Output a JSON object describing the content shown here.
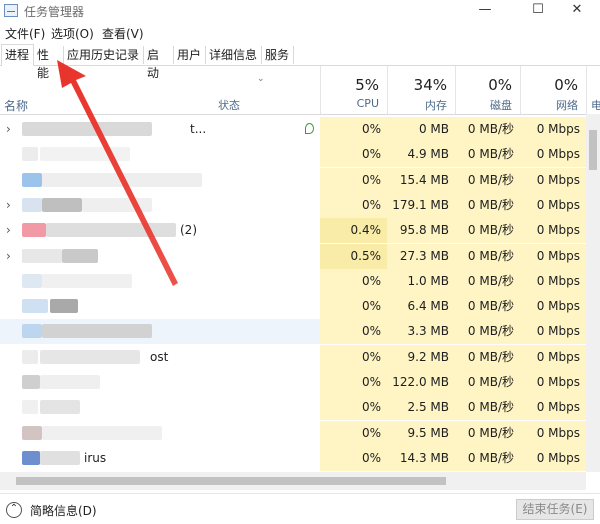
{
  "window": {
    "title": "任务管理器",
    "controls": {
      "minimize": "—",
      "maximize": "☐",
      "close": "✕"
    }
  },
  "menu": [
    "文件(F)",
    "选项(O)",
    "查看(V)"
  ],
  "tabs": [
    "进程",
    "性能",
    "应用历史记录",
    "启动",
    "用户",
    "详细信息",
    "服务"
  ],
  "columns": {
    "name": "名称",
    "status": "状态",
    "cpu": {
      "pct": "5%",
      "label": "CPU"
    },
    "mem": {
      "pct": "34%",
      "label": "内存"
    },
    "disk": {
      "pct": "0%",
      "label": "磁盘"
    },
    "net": {
      "pct": "0%",
      "label": "网络"
    },
    "extra": "电"
  },
  "rows": [
    {
      "name": "t...",
      "expand": true,
      "cpu": "0%",
      "mem": "0 MB",
      "disk": "0 MB/秒",
      "net": "0 Mbps"
    },
    {
      "name": "",
      "expand": false,
      "cpu": "0%",
      "mem": "4.9 MB",
      "disk": "0 MB/秒",
      "net": "0 Mbps"
    },
    {
      "name": "",
      "expand": false,
      "cpu": "0%",
      "mem": "15.4 MB",
      "disk": "0 MB/秒",
      "net": "0 Mbps"
    },
    {
      "name": "",
      "expand": true,
      "cpu": "0%",
      "mem": "179.1 MB",
      "disk": "0 MB/秒",
      "net": "0 Mbps"
    },
    {
      "name": "(2)",
      "expand": true,
      "cpu": "0.4%",
      "mem": "95.8 MB",
      "disk": "0 MB/秒",
      "net": "0 Mbps"
    },
    {
      "name": "",
      "expand": true,
      "cpu": "0.5%",
      "mem": "27.3 MB",
      "disk": "0 MB/秒",
      "net": "0 Mbps"
    },
    {
      "name": "",
      "expand": false,
      "cpu": "0%",
      "mem": "1.0 MB",
      "disk": "0 MB/秒",
      "net": "0 Mbps"
    },
    {
      "name": "",
      "expand": false,
      "cpu": "0%",
      "mem": "6.4 MB",
      "disk": "0 MB/秒",
      "net": "0 Mbps"
    },
    {
      "name": "",
      "expand": false,
      "cpu": "0%",
      "mem": "3.3 MB",
      "disk": "0 MB/秒",
      "net": "0 Mbps"
    },
    {
      "name": "ost",
      "expand": false,
      "cpu": "0%",
      "mem": "9.2 MB",
      "disk": "0 MB/秒",
      "net": "0 Mbps"
    },
    {
      "name": "",
      "expand": false,
      "cpu": "0%",
      "mem": "122.0 MB",
      "disk": "0 MB/秒",
      "net": "0 Mbps"
    },
    {
      "name": "",
      "expand": false,
      "cpu": "0%",
      "mem": "2.5 MB",
      "disk": "0 MB/秒",
      "net": "0 Mbps"
    },
    {
      "name": "",
      "expand": false,
      "cpu": "0%",
      "mem": "9.5 MB",
      "disk": "0 MB/秒",
      "net": "0 Mbps"
    },
    {
      "name": "irus",
      "expand": false,
      "cpu": "0%",
      "mem": "14.3 MB",
      "disk": "0 MB/秒",
      "net": "0 Mbps"
    }
  ],
  "footer": {
    "fewer_details": "简略信息(D)",
    "end_task": "结束任务(E)"
  },
  "icons": {
    "expand": "chevron-right-icon",
    "collapse": "chevron-up-icon",
    "eco": "leaf-icon"
  },
  "colors": {
    "highlight": "#fff4c4",
    "highlight_strong": "#f9eca8",
    "selected_row": "#eef4fb",
    "annotation_arrow": "#e8332a"
  }
}
